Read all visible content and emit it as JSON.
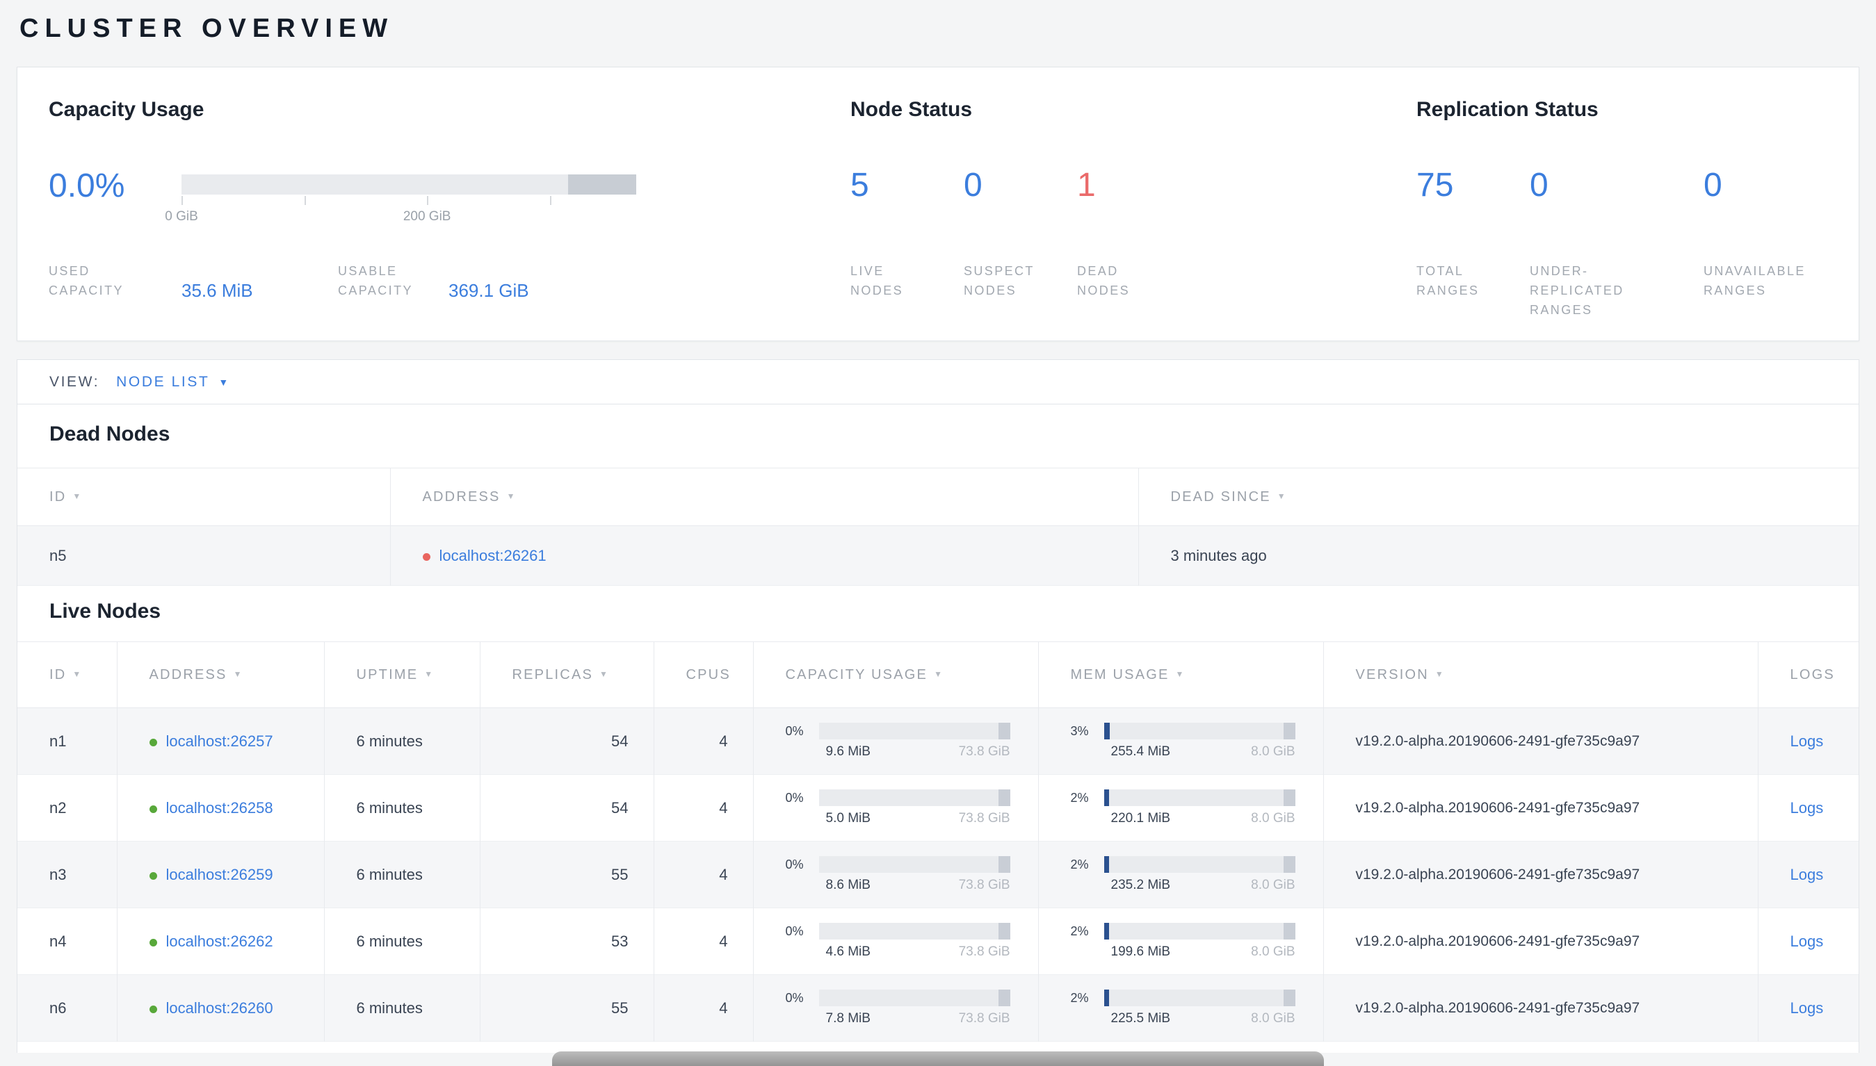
{
  "page": {
    "title": "CLUSTER OVERVIEW"
  },
  "colors": {
    "accent_blue": "#3b7ddd",
    "danger_red": "#ea6a6a",
    "live_dot_green": "#58a83a",
    "dead_dot_red": "#e9655f",
    "mem_fill_navy": "#2b518f"
  },
  "summary": {
    "capacity": {
      "heading": "Capacity Usage",
      "percent": "0.0%",
      "used_label": "USED CAPACITY",
      "used_value": "35.6 MiB",
      "usable_label": "USABLE CAPACITY",
      "usable_value": "369.1 GiB",
      "axis_ticks": [
        "0 GiB",
        "200 GiB"
      ],
      "gauge": {
        "used_pct": 0,
        "segment_start_pct": 85
      }
    },
    "node_status": {
      "heading": "Node Status",
      "stats": [
        {
          "value": "5",
          "label": "LIVE NODES"
        },
        {
          "value": "0",
          "label": "SUSPECT NODES"
        },
        {
          "value": "1",
          "label": "DEAD NODES"
        }
      ]
    },
    "replication": {
      "heading": "Replication Status",
      "stats": [
        {
          "value": "75",
          "label": "TOTAL RANGES"
        },
        {
          "value": "0",
          "label": "UNDER-REPLICATED RANGES"
        },
        {
          "value": "0",
          "label": "UNAVAILABLE RANGES"
        }
      ]
    }
  },
  "view_bar": {
    "label": "VIEW:",
    "selected": "NODE LIST"
  },
  "dead_nodes": {
    "heading": "Dead Nodes",
    "columns": [
      {
        "label": "ID",
        "sortable": true
      },
      {
        "label": "ADDRESS",
        "sortable": true
      },
      {
        "label": "DEAD SINCE",
        "sortable": true
      }
    ],
    "rows": [
      {
        "id": "n5",
        "address": "localhost:26261",
        "dead_since": "3 minutes ago"
      }
    ]
  },
  "live_nodes": {
    "heading": "Live Nodes",
    "columns": [
      {
        "label": "ID",
        "sortable": true
      },
      {
        "label": "ADDRESS",
        "sortable": true
      },
      {
        "label": "UPTIME",
        "sortable": true
      },
      {
        "label": "REPLICAS",
        "sortable": true
      },
      {
        "label": "CPUS",
        "sortable": false
      },
      {
        "label": "CAPACITY USAGE",
        "sortable": true
      },
      {
        "label": "MEM USAGE",
        "sortable": true
      },
      {
        "label": "VERSION",
        "sortable": true
      },
      {
        "label": "LOGS",
        "sortable": false
      }
    ],
    "rows": [
      {
        "id": "n1",
        "address": "localhost:26257",
        "uptime": "6 minutes",
        "replicas": "54",
        "cpus": "4",
        "capacity": {
          "percent": "0%",
          "used": "9.6 MiB",
          "total": "73.8 GiB",
          "fill_pct": 0
        },
        "mem": {
          "percent": "3%",
          "used": "255.4 MiB",
          "total": "8.0 GiB",
          "fill_pct": 3
        },
        "version": "v19.2.0-alpha.20190606-2491-gfe735c9a97",
        "logs": "Logs"
      },
      {
        "id": "n2",
        "address": "localhost:26258",
        "uptime": "6 minutes",
        "replicas": "54",
        "cpus": "4",
        "capacity": {
          "percent": "0%",
          "used": "5.0 MiB",
          "total": "73.8 GiB",
          "fill_pct": 0
        },
        "mem": {
          "percent": "2%",
          "used": "220.1 MiB",
          "total": "8.0 GiB",
          "fill_pct": 2
        },
        "version": "v19.2.0-alpha.20190606-2491-gfe735c9a97",
        "logs": "Logs"
      },
      {
        "id": "n3",
        "address": "localhost:26259",
        "uptime": "6 minutes",
        "replicas": "55",
        "cpus": "4",
        "capacity": {
          "percent": "0%",
          "used": "8.6 MiB",
          "total": "73.8 GiB",
          "fill_pct": 0
        },
        "mem": {
          "percent": "2%",
          "used": "235.2 MiB",
          "total": "8.0 GiB",
          "fill_pct": 2
        },
        "version": "v19.2.0-alpha.20190606-2491-gfe735c9a97",
        "logs": "Logs"
      },
      {
        "id": "n4",
        "address": "localhost:26262",
        "uptime": "6 minutes",
        "replicas": "53",
        "cpus": "4",
        "capacity": {
          "percent": "0%",
          "used": "4.6 MiB",
          "total": "73.8 GiB",
          "fill_pct": 0
        },
        "mem": {
          "percent": "2%",
          "used": "199.6 MiB",
          "total": "8.0 GiB",
          "fill_pct": 2
        },
        "version": "v19.2.0-alpha.20190606-2491-gfe735c9a97",
        "logs": "Logs"
      },
      {
        "id": "n6",
        "address": "localhost:26260",
        "uptime": "6 minutes",
        "replicas": "55",
        "cpus": "4",
        "capacity": {
          "percent": "0%",
          "used": "7.8 MiB",
          "total": "73.8 GiB",
          "fill_pct": 0
        },
        "mem": {
          "percent": "2%",
          "used": "225.5 MiB",
          "total": "8.0 GiB",
          "fill_pct": 2
        },
        "version": "v19.2.0-alpha.20190606-2491-gfe735c9a97",
        "logs": "Logs"
      }
    ]
  }
}
